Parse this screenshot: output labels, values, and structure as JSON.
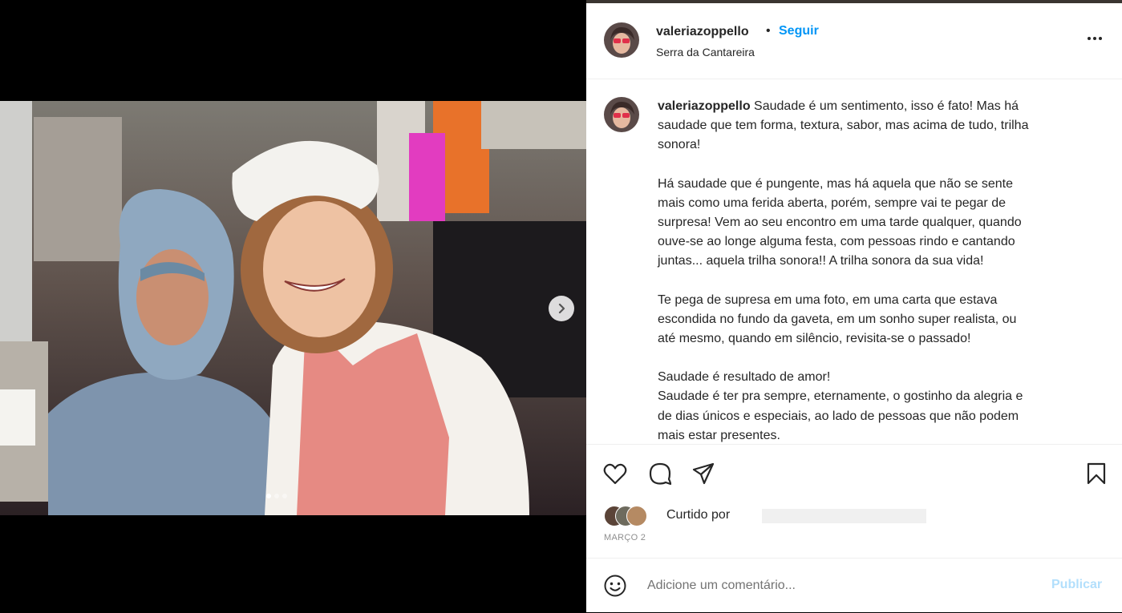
{
  "post": {
    "username": "valeriazoppello",
    "separator": "•",
    "follow_label": "Seguir",
    "location": "Serra da Cantareira",
    "more_icon": "more-horizontal-icon"
  },
  "media": {
    "next_icon": "chevron-right-icon",
    "slide_count": 3,
    "active_slide": 1
  },
  "caption": {
    "username": "valeriazoppello",
    "paragraphs": [
      [
        "Saudade é um sentimento, isso é fato! Mas há",
        "saudade que tem forma, textura, sabor, mas acima de tudo, trilha",
        "sonora!"
      ],
      [
        "Há saudade que é pungente, mas há aquela que não se sente",
        "mais como uma ferida aberta, porém, sempre vai te pegar de",
        "surpresa! Vem ao seu encontro em uma tarde qualquer, quando",
        "ouve-se ao longe alguma festa, com pessoas rindo e cantando",
        "juntas... aquela trilha sonora!! A trilha sonora da sua vida!"
      ],
      [
        "Te pega de supresa em uma foto, em uma carta que estava",
        "escondida no fundo da gaveta, em um sonho super realista, ou",
        "até mesmo, quando em silêncio, revisita-se o passado!"
      ],
      [
        "Saudade é resultado de amor!",
        "Saudade é ter pra sempre, eternamente, o gostinho da alegria e",
        "de dias únicos e especiais, ao lado de pessoas que não podem",
        "mais estar presentes."
      ]
    ]
  },
  "actions": {
    "like_icon": "heart-icon",
    "comment_icon": "comment-icon",
    "share_icon": "share-icon",
    "save_icon": "bookmark-icon"
  },
  "likes": {
    "text": "Curtido por"
  },
  "date": "MARÇO 2",
  "comment": {
    "emoji_icon": "emoji-icon",
    "placeholder": "Adicione um comentário...",
    "publish_label": "Publicar"
  },
  "colors": {
    "accent": "#0095f6",
    "publish_disabled": "#b2dffc",
    "text": "#262626",
    "secondary": "#8e8e8e"
  }
}
